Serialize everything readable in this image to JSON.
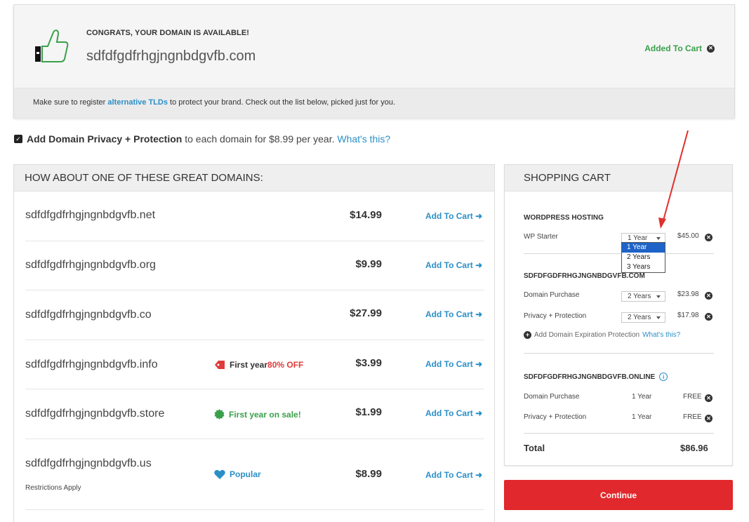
{
  "banner": {
    "congrats": "CONGRATS, YOUR DOMAIN IS AVAILABLE!",
    "domain": "sdfdfgdfrhgjngnbdgvfb.com",
    "added_label": "Added To Cart",
    "tld_pre": "Make sure to register ",
    "tld_link": "alternative TLDs",
    "tld_post": " to protect your brand. Check out the list below, picked just for you."
  },
  "privacy": {
    "checked": true,
    "bold": "Add Domain Privacy + Protection",
    "text": " to each domain for $8.99 per year. ",
    "link": "What's this?"
  },
  "suggestions": {
    "header": "HOW ABOUT ONE OF THESE GREAT DOMAINS:",
    "add_label": "Add To Cart",
    "rows": [
      {
        "domain": "sdfdfgdfrhgjngnbdgvfb.net",
        "price": "$14.99"
      },
      {
        "domain": "sdfdfgdfrhgjngnbdgvfb.org",
        "price": "$9.99"
      },
      {
        "domain": "sdfdfgdfrhgjngnbdgvfb.co",
        "price": "$27.99"
      },
      {
        "domain": "sdfdfgdfrhgjngnbdgvfb.info",
        "price": "$3.99",
        "promo_pre": "First year ",
        "promo_hl": "80% OFF"
      },
      {
        "domain": "sdfdfgdfrhgjngnbdgvfb.store",
        "price": "$1.99",
        "promo": "First year on sale!"
      },
      {
        "domain": "sdfdfgdfrhgjngnbdgvfb.us",
        "price": "$8.99",
        "promo": "Popular",
        "note": "Restrictions Apply"
      }
    ]
  },
  "cart": {
    "header": "SHOPPING CART",
    "wp": {
      "title": "WORDPRESS HOSTING",
      "item": "WP Starter",
      "term": "1 Year",
      "price": "$45.00"
    },
    "dropdown_options": [
      "1 Year",
      "2 Years",
      "3 Years"
    ],
    "com": {
      "title": "SDFDFGDFRHGJNGNBDGVFB.COM",
      "purchase": {
        "label": "Domain Purchase",
        "term": "2 Years",
        "price": "$23.98"
      },
      "privacy": {
        "label": "Privacy + Protection",
        "term": "2 Years",
        "price": "$17.98"
      },
      "expiration": "Add Domain Expiration Protection",
      "expiration_link": "What's this?"
    },
    "online": {
      "title": "SDFDFGDFRHGJNGNBDGVFB.ONLINE",
      "purchase": {
        "label": "Domain Purchase",
        "term": "1 Year",
        "price": "FREE"
      },
      "privacy": {
        "label": "Privacy + Protection",
        "term": "1 Year",
        "price": "FREE"
      }
    },
    "total_label": "Total",
    "total": "$86.96"
  },
  "continue_label": "Continue",
  "colors": {
    "accent_blue": "#2b8fc7",
    "success_green": "#3aa04a",
    "continue_red": "#e1282c",
    "promo_red": "#e03a3a"
  }
}
